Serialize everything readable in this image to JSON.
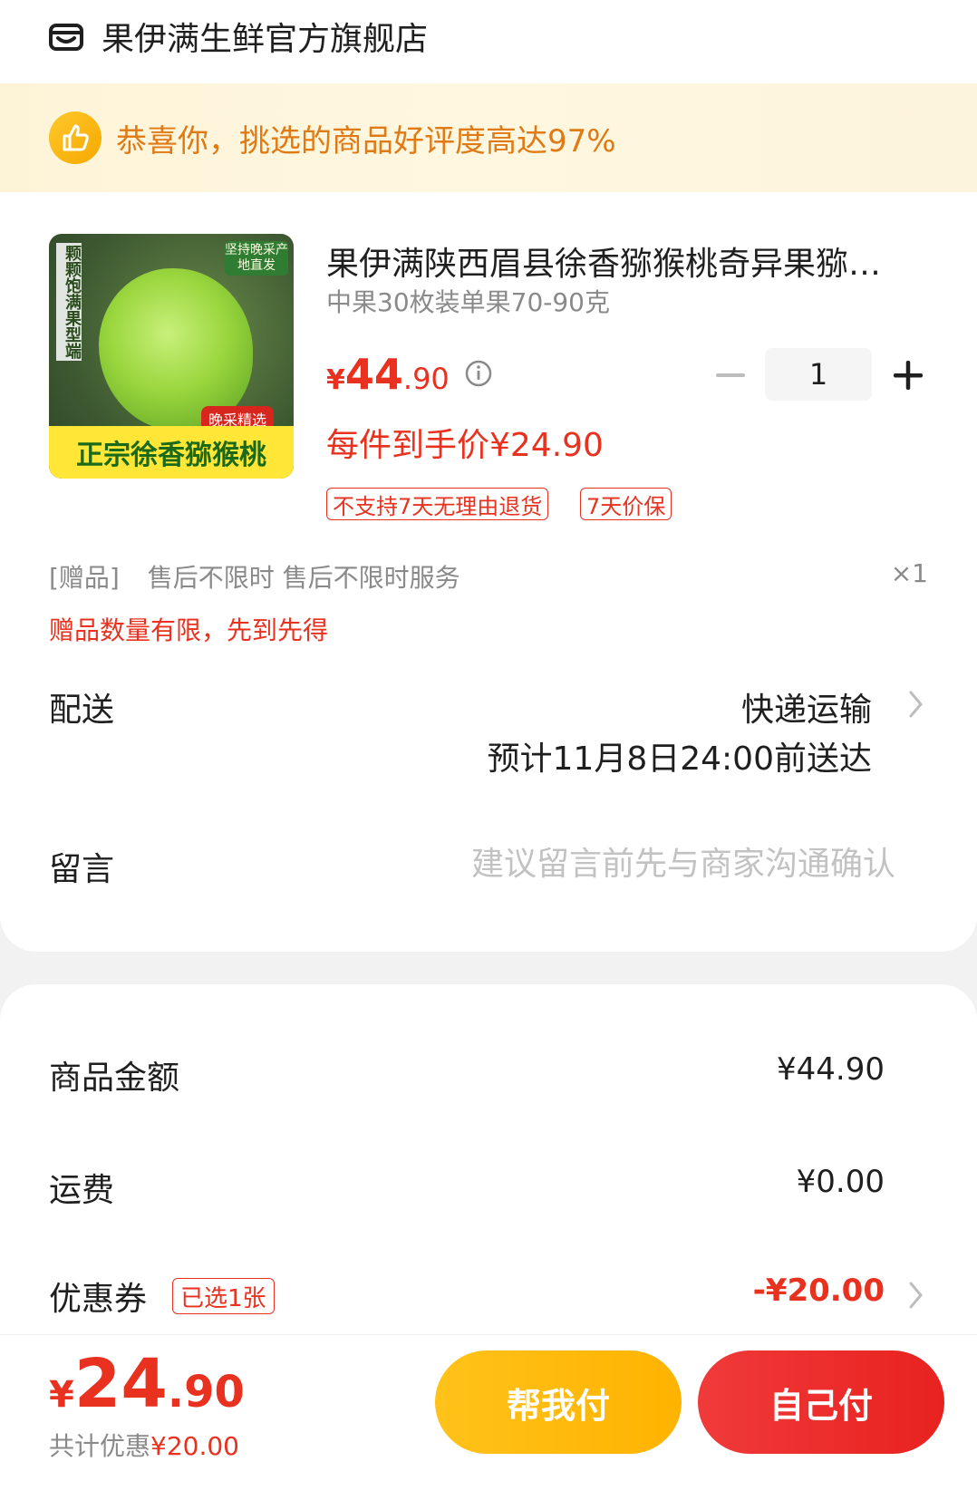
{
  "shop": {
    "name": "果伊满生鲜官方旗舰店",
    "icon": "shop-icon"
  },
  "banner": {
    "icon": "thumbs-up-icon",
    "text": "恭喜你，挑选的商品好评度高达97%"
  },
  "product": {
    "image_texts": {
      "side": "颗颗饱满果型端",
      "top_right": "坚持晚采产地直发",
      "mini_tag": "晚采精选",
      "bottom": "正宗徐香猕猴桃"
    },
    "title": "果伊满陕西眉县徐香猕猴桃奇异果猕…",
    "spec": "中果30枚装单果70-90克",
    "price": {
      "yen": "¥",
      "int": "44",
      "dec": ".90"
    },
    "quantity": "1",
    "hand_price": "每件到手价¥24.90",
    "tags": [
      "不支持7天无理由退货",
      "7天价保"
    ]
  },
  "gift": {
    "label": "[赠品]",
    "name": "售后不限时 售后不限时服务",
    "qty": "×1",
    "note": "赠品数量有限，先到先得"
  },
  "delivery": {
    "label": "配送",
    "method": "快递运输",
    "eta": "预计11月8日24:00前送达"
  },
  "message": {
    "label": "留言",
    "placeholder": "建议留言前先与商家沟通确认"
  },
  "summary": {
    "goods_label": "商品金额",
    "goods_value": "¥44.90",
    "shipping_label": "运费",
    "shipping_value": "¥0.00",
    "coupon_label": "优惠券",
    "coupon_tag": "已选1张",
    "coupon_value": "-¥20.00"
  },
  "footer": {
    "total": {
      "yen": "¥",
      "int": "24",
      "dec": ".90"
    },
    "save_prefix": "共计优惠",
    "save_value": "¥20.00",
    "help_pay": "帮我付",
    "self_pay": "自己付"
  },
  "colors": {
    "accent_red": "#e8311f",
    "banner_orange": "#e07a14",
    "help_btn": "#ffb300",
    "pay_btn": "#e8221f"
  }
}
